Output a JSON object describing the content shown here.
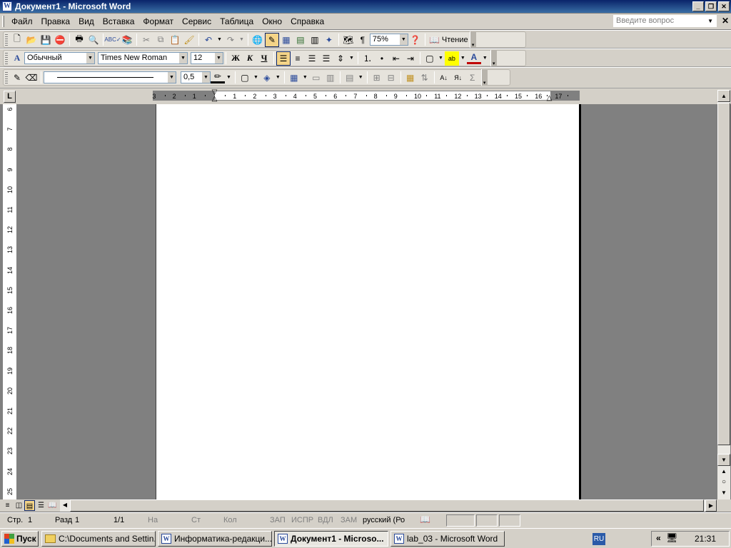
{
  "window": {
    "title": "Документ1 - Microsoft Word"
  },
  "menu": {
    "items": [
      "Файл",
      "Правка",
      "Вид",
      "Вставка",
      "Формат",
      "Сервис",
      "Таблица",
      "Окно",
      "Справка"
    ],
    "ask_placeholder": "Введите вопрос"
  },
  "toolbar_standard": {
    "zoom": "75%",
    "reading": "Чтение"
  },
  "toolbar_format": {
    "style": "Обычный",
    "font": "Times New Roman",
    "size": "12",
    "bold": "Ж",
    "italic": "К",
    "underline": "Ч"
  },
  "toolbar_draw": {
    "line_weight": "0,5"
  },
  "ruler": {
    "h_left_labels": [
      "3",
      "2",
      "1"
    ],
    "h_labels": [
      "1",
      "2",
      "3",
      "4",
      "5",
      "6",
      "7",
      "8",
      "9",
      "10",
      "11",
      "12",
      "13",
      "14",
      "15",
      "16",
      "17"
    ],
    "v_labels": [
      "6",
      "7",
      "8",
      "9",
      "10",
      "11",
      "12",
      "13",
      "14",
      "15",
      "16",
      "17",
      "18",
      "19",
      "20",
      "21",
      "22",
      "23",
      "24",
      "25"
    ]
  },
  "status": {
    "page": "Стр.",
    "page_num": "1",
    "section": "Разд",
    "section_num": "1",
    "pages": "1/1",
    "at": "На",
    "line": "Ст",
    "col": "Кол",
    "rec": "ЗАП",
    "trk": "ИСПР",
    "ext": "ВДЛ",
    "ovr": "ЗАМ",
    "language": "русский (Ро"
  },
  "taskbar": {
    "start": "Пуск",
    "tasks": [
      "C:\\Documents and Settin...",
      "Информатика-редакци...",
      "Документ1 - Microso...",
      "lab_03 - Microsoft Word"
    ],
    "lang": "RU",
    "clock": "21:31"
  }
}
